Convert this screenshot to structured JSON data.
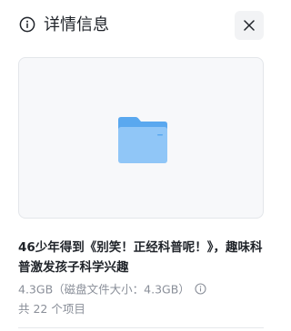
{
  "header": {
    "title": "详情信息",
    "info_icon": "info-circle-icon",
    "close_icon": "close-icon"
  },
  "preview": {
    "icon": "folder-icon",
    "folder_color_light": "#90c6f7",
    "folder_color_dark": "#5aa8ef"
  },
  "item": {
    "name": "46少年得到《别笑！正经科普呢！》，趣味科普激发孩子科学兴趣",
    "size": "4.3GB",
    "disk_size": "（磁盘文件大小：4.3GB）",
    "count": "共 22 个项目"
  }
}
